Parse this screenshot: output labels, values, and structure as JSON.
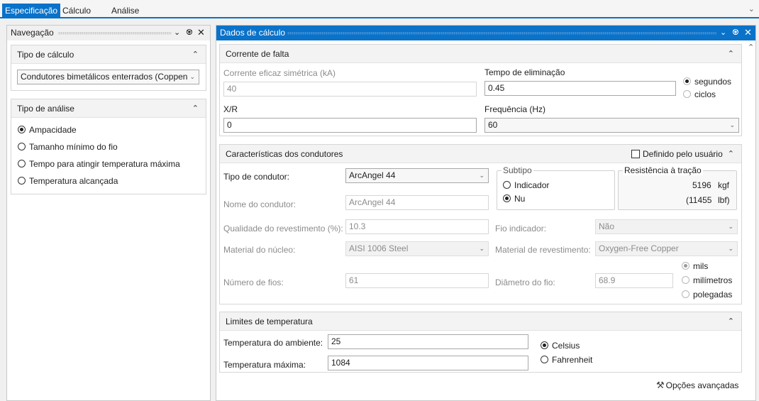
{
  "tabs": [
    "Especificação",
    "Cálculo",
    "Análise"
  ],
  "nav": {
    "title": "Navegação",
    "calc_type": {
      "header": "Tipo de cálculo",
      "value": "Condutores bimetálicos enterrados (Coppen"
    },
    "analysis_type": {
      "header": "Tipo de análise",
      "options": [
        "Ampacidade",
        "Tamanho mínimo do fio",
        "Tempo para atingir temperatura máxima",
        "Temperatura alcançada"
      ],
      "selected": 0
    }
  },
  "calc": {
    "title": "Dados de cálculo",
    "fault": {
      "header": "Corrente de falta",
      "rms_label": "Corrente eficaz simétrica (kA)",
      "rms_value": "40",
      "clear_label": "Tempo de eliminação",
      "clear_value": "0.45",
      "time_units": [
        "segundos",
        "ciclos"
      ],
      "xr_label": "X/R",
      "xr_value": "0",
      "freq_label": "Frequência (Hz)",
      "freq_value": "60"
    },
    "conductor": {
      "header": "Características dos condutores",
      "user_defined": "Definido pelo usuário",
      "type_label": "Tipo de condutor:",
      "type_value": "ArcAngel 44",
      "name_label": "Nome do condutor:",
      "name_value": "ArcAngel 44",
      "subtype_legend": "Subtipo",
      "subtype_options": [
        "Indicador",
        "Nu"
      ],
      "tensile_legend": "Resistência à tração",
      "tensile_kgf": "5196",
      "tensile_kgf_unit": "kgf",
      "tensile_lbf": "(11455",
      "tensile_lbf_unit": "lbf)",
      "coating_label": "Qualidade do revestimento (%):",
      "coating_value": "10.3",
      "indicator_label": "Fio indicador:",
      "indicator_value": "Não",
      "core_label": "Material do núcleo:",
      "core_value": "AISI 1006 Steel",
      "cladding_label": "Material de revestimento:",
      "cladding_value": "Oxygen-Free Copper",
      "strands_label": "Número de fios:",
      "strands_value": "61",
      "diameter_label": "Diâmetro do fio:",
      "diameter_value": "68.9",
      "diameter_units": [
        "mils",
        "milímetros",
        "polegadas"
      ]
    },
    "temperature": {
      "header": "Limites de temperatura",
      "ambient_label": "Temperatura do ambiente:",
      "ambient_value": "25",
      "max_label": "Temperatura máxima:",
      "max_value": "1084",
      "units": [
        "Celsius",
        "Fahrenheit"
      ]
    },
    "advanced": "Opções avançadas"
  },
  "colors": {
    "accent": "#0a72c9"
  }
}
